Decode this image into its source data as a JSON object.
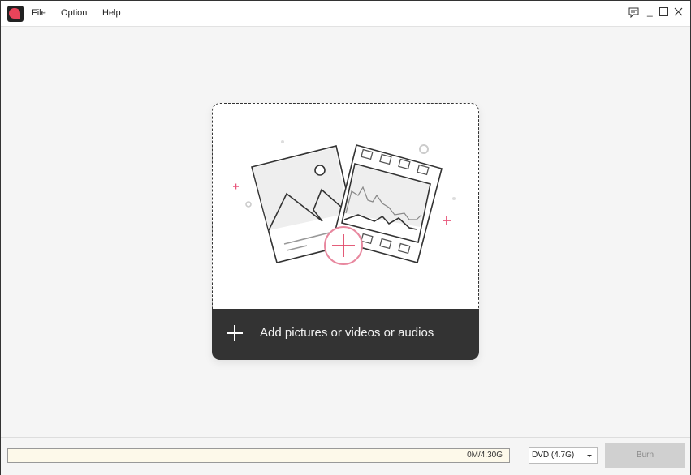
{
  "menu": {
    "file": "File",
    "option": "Option",
    "help": "Help"
  },
  "window_controls": {
    "feedback": "feedback-icon",
    "minimize": "_",
    "maximize": "☐",
    "close": "✕"
  },
  "dropzone": {
    "label": "Add pictures or videos or audios",
    "accent": "#e8557a"
  },
  "footer": {
    "capacity": "0M/4.30G",
    "capacity_used_fraction": 0,
    "disc_type": "DVD (4.7G)",
    "burn_label": "Burn"
  }
}
